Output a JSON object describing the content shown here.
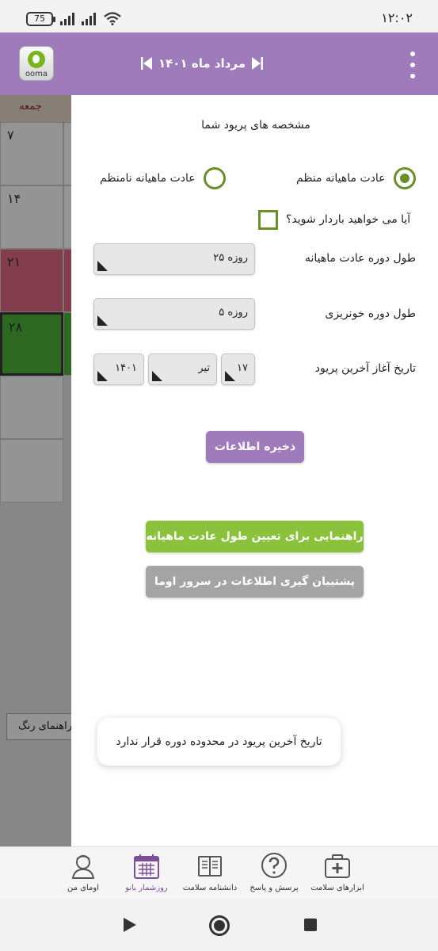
{
  "status_bar": {
    "battery": "75",
    "time": "۱۲:۰۲"
  },
  "app_bar": {
    "logo_text": "ooma",
    "month_title": "مرداد ماه ۱۴۰۱",
    "colors": {
      "primary": "#9f7bbc"
    }
  },
  "calendar_backdrop": {
    "header_day": "جمعه",
    "day_numbers": [
      "۷",
      "۱۴",
      "۲۱",
      "۲۸"
    ],
    "color_guide_label": "راهنمای رنگ"
  },
  "settings_panel": {
    "title": "مشخصه های پریود شما",
    "regular_label": "عادت ماهیانه منظم",
    "irregular_label": "عادت ماهیانه نامنظم",
    "regular_selected": true,
    "pregnancy_question": "آیا می خواهید باردار شوید؟",
    "pregnancy_checked": false,
    "cycle_length_label": "طول دوره عادت ماهیانه",
    "cycle_length_value": "۲۵ روزه",
    "bleeding_length_label": "طول دوره خونریزی",
    "bleeding_length_value": "۵ روزه",
    "last_period_label": "تاریخ آغاز آخرین پریود",
    "last_period_day": "۱۷",
    "last_period_month": "تیر",
    "last_period_year": "۱۴۰۱",
    "save_button": "ذخیره اطلاعات",
    "guide_button": "راهنمایی برای تعیین طول عادت ماهیانه",
    "backup_button": "پشتیبان گیری اطلاعات در سرور اوما"
  },
  "toast": {
    "message": "تاریخ آخرین پریود در محدوده دوره قرار ندارد"
  },
  "bottom_nav": {
    "items": [
      {
        "label": "ابزارهای سلامت",
        "icon": "medical-kit-icon"
      },
      {
        "label": "پرسش و پاسخ",
        "icon": "question-bubble-icon"
      },
      {
        "label": "دانشنامه سلامت",
        "icon": "encyclopedia-icon"
      },
      {
        "label": "روزشمار بانو",
        "icon": "calendar-icon"
      },
      {
        "label": "اومای من",
        "icon": "profile-icon"
      }
    ],
    "active_index": 3
  }
}
